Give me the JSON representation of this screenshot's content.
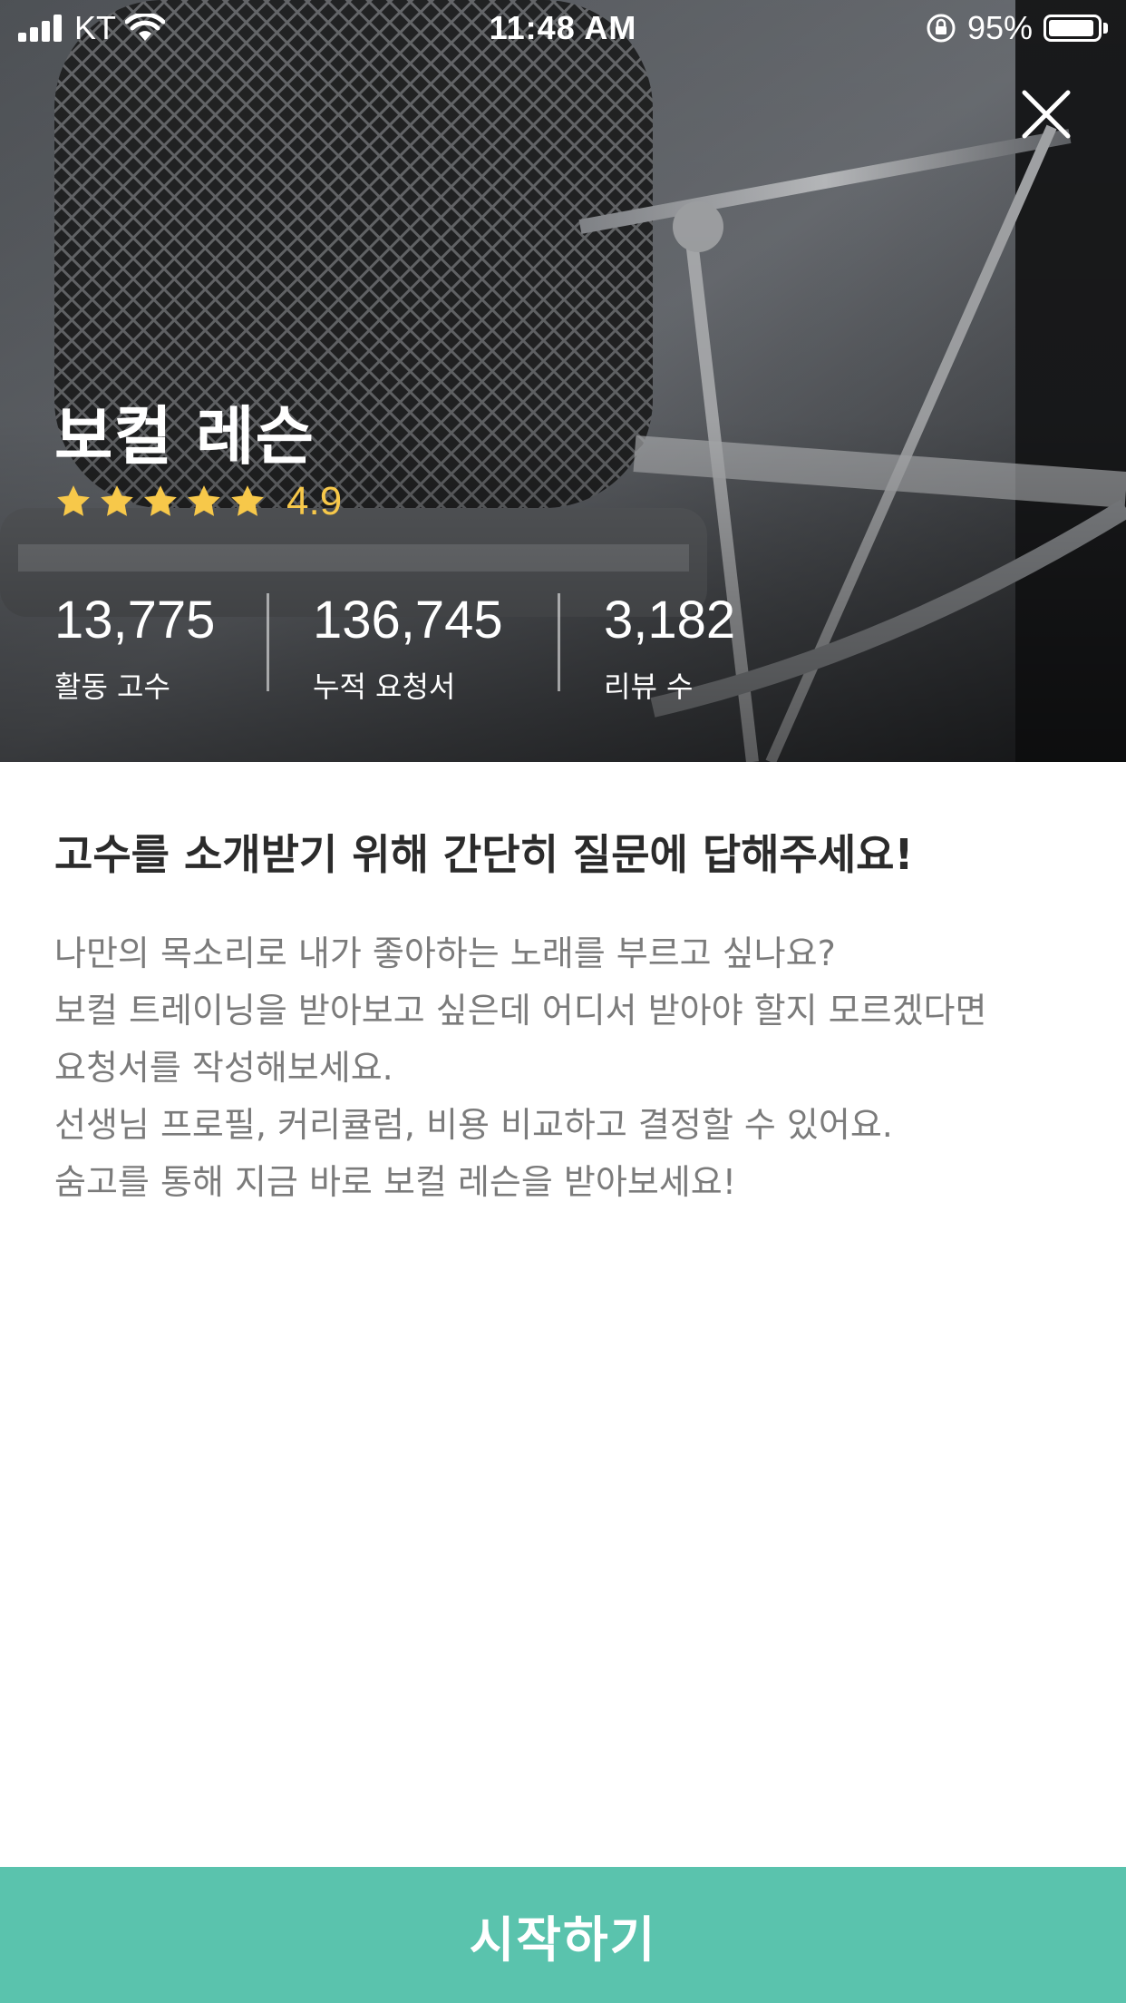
{
  "status_bar": {
    "carrier": "KT",
    "time": "11:48 AM",
    "battery_percent": "95%",
    "battery_level": 0.95,
    "icons": [
      "signal-icon",
      "wifi-icon",
      "rotation-lock-icon",
      "battery-icon"
    ]
  },
  "hero": {
    "title": "보컬 레슨",
    "rating": {
      "value": "4.9",
      "stars": 5,
      "star_color": "#F7C84A"
    },
    "stats": [
      {
        "number": "13,775",
        "label": "활동 고수"
      },
      {
        "number": "136,745",
        "label": "누적 요청서"
      },
      {
        "number": "3,182",
        "label": "리뷰 수"
      }
    ],
    "close_icon": "close-icon"
  },
  "content": {
    "heading": "고수를 소개받기 위해 간단히 질문에 답해주세요!",
    "description_lines": [
      "나만의 목소리로 내가 좋아하는 노래를 부르고 싶나요?",
      "보컬 트레이닝을 받아보고 싶은데 어디서 받아야 할지 모르겠다면",
      "요청서를 작성해보세요.",
      "선생님 프로필, 커리큘럼, 비용 비교하고 결정할 수 있어요.",
      "숨고를 통해 지금 바로 보컬 레슨을 받아보세요!"
    ]
  },
  "footer": {
    "start_label": "시작하기"
  },
  "colors": {
    "accent": "#5AC3AD",
    "heading_text": "#2B2B2B",
    "body_text": "#7B7B7B"
  }
}
